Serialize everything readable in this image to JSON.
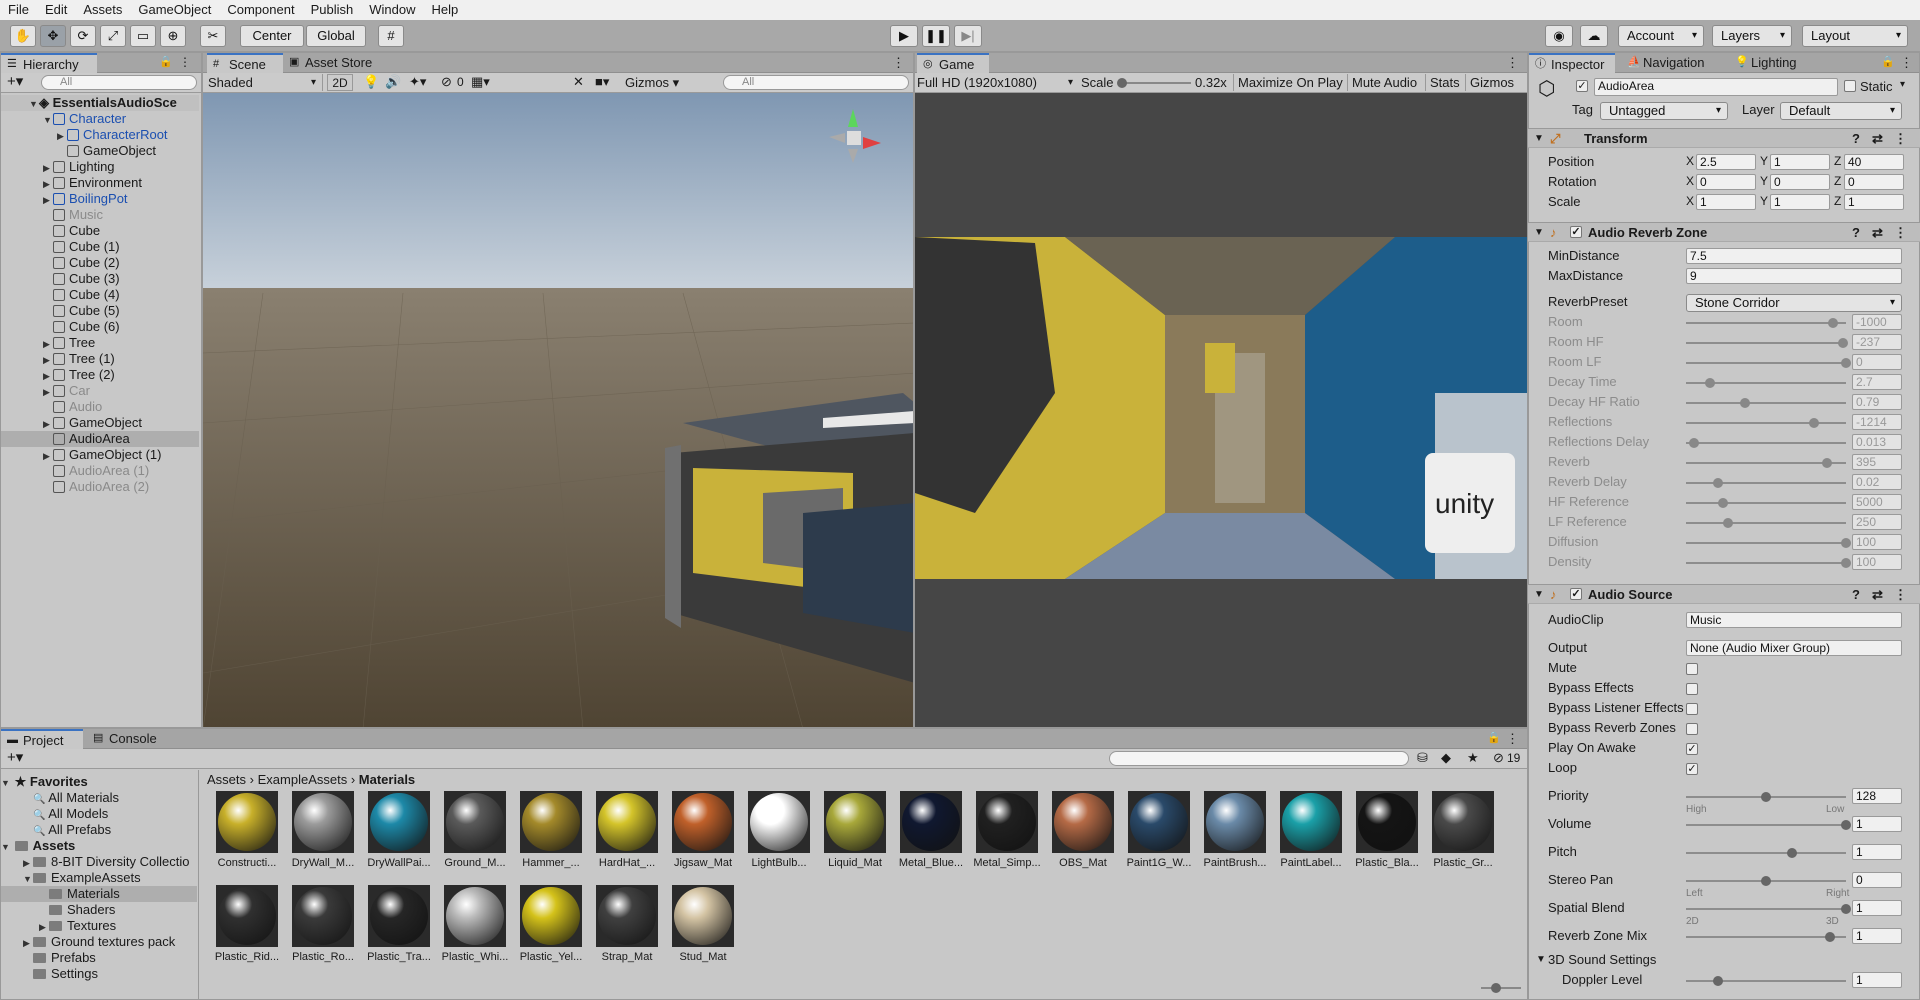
{
  "menu": [
    "File",
    "Edit",
    "Assets",
    "GameObject",
    "Component",
    "Publish",
    "Window",
    "Help"
  ],
  "toolbar": {
    "center": "Center",
    "global": "Global",
    "account": "Account",
    "layers": "Layers",
    "layout": "Layout"
  },
  "hierarchy": {
    "tab": "Hierarchy",
    "search_placeholder": "All",
    "scene": "EssentialsAudioSce",
    "items": [
      {
        "label": "Character",
        "indent": 1,
        "arrow": "▼",
        "style": "blue"
      },
      {
        "label": "CharacterRoot",
        "indent": 2,
        "arrow": "▶",
        "style": "blue"
      },
      {
        "label": "GameObject",
        "indent": 2,
        "arrow": "",
        "style": ""
      },
      {
        "label": "Lighting",
        "indent": 1,
        "arrow": "▶",
        "style": ""
      },
      {
        "label": "Environment",
        "indent": 1,
        "arrow": "▶",
        "style": ""
      },
      {
        "label": "BoilingPot",
        "indent": 1,
        "arrow": "▶",
        "style": "blue"
      },
      {
        "label": "Music",
        "indent": 1,
        "arrow": "",
        "style": "gray"
      },
      {
        "label": "Cube",
        "indent": 1,
        "arrow": "",
        "style": ""
      },
      {
        "label": "Cube (1)",
        "indent": 1,
        "arrow": "",
        "style": ""
      },
      {
        "label": "Cube (2)",
        "indent": 1,
        "arrow": "",
        "style": ""
      },
      {
        "label": "Cube (3)",
        "indent": 1,
        "arrow": "",
        "style": ""
      },
      {
        "label": "Cube (4)",
        "indent": 1,
        "arrow": "",
        "style": ""
      },
      {
        "label": "Cube (5)",
        "indent": 1,
        "arrow": "",
        "style": ""
      },
      {
        "label": "Cube (6)",
        "indent": 1,
        "arrow": "",
        "style": ""
      },
      {
        "label": "Tree",
        "indent": 1,
        "arrow": "▶",
        "style": ""
      },
      {
        "label": "Tree (1)",
        "indent": 1,
        "arrow": "▶",
        "style": ""
      },
      {
        "label": "Tree (2)",
        "indent": 1,
        "arrow": "▶",
        "style": ""
      },
      {
        "label": "Car",
        "indent": 1,
        "arrow": "▶",
        "style": "gray"
      },
      {
        "label": "Audio",
        "indent": 1,
        "arrow": "",
        "style": "gray"
      },
      {
        "label": "GameObject",
        "indent": 1,
        "arrow": "▶",
        "style": ""
      },
      {
        "label": "AudioArea",
        "indent": 1,
        "arrow": "",
        "style": "sel"
      },
      {
        "label": "GameObject (1)",
        "indent": 1,
        "arrow": "▶",
        "style": ""
      },
      {
        "label": "AudioArea (1)",
        "indent": 1,
        "arrow": "",
        "style": "gray"
      },
      {
        "label": "AudioArea (2)",
        "indent": 1,
        "arrow": "",
        "style": "gray"
      }
    ]
  },
  "scene": {
    "tab": "Scene",
    "tab2": "Asset Store",
    "shading": "Shaded",
    "mode2d": "2D",
    "hidden_count": "0",
    "gizmos": "Gizmos",
    "search_placeholder": "All"
  },
  "game": {
    "tab": "Game",
    "resolution": "Full HD (1920x1080)",
    "scale_label": "Scale",
    "scale_value": "0.32x",
    "maximize": "Maximize On Play",
    "mute": "Mute Audio",
    "stats": "Stats",
    "gizmos": "Gizmos"
  },
  "inspector": {
    "tabs": [
      "Inspector",
      "Navigation",
      "Lighting"
    ],
    "object_name": "AudioArea",
    "static": "Static",
    "tag_label": "Tag",
    "tag": "Untagged",
    "layer_label": "Layer",
    "layer": "Default",
    "transform": {
      "title": "Transform",
      "rows": [
        {
          "label": "Position",
          "x": "2.5",
          "y": "1",
          "z": "40"
        },
        {
          "label": "Rotation",
          "x": "0",
          "y": "0",
          "z": "0"
        },
        {
          "label": "Scale",
          "x": "1",
          "y": "1",
          "z": "1"
        }
      ]
    },
    "reverb": {
      "title": "Audio Reverb Zone",
      "min_label": "MinDistance",
      "min": "7.5",
      "max_label": "MaxDistance",
      "max": "9",
      "preset_label": "ReverbPreset",
      "preset": "Stone Corridor",
      "sliders": [
        {
          "label": "Room",
          "value": "-1000",
          "pos": 0.92
        },
        {
          "label": "Room HF",
          "value": "-237",
          "pos": 0.98
        },
        {
          "label": "Room LF",
          "value": "0",
          "pos": 1.0
        },
        {
          "label": "Decay Time",
          "value": "2.7",
          "pos": 0.15
        },
        {
          "label": "Decay HF Ratio",
          "value": "0.79",
          "pos": 0.37
        },
        {
          "label": "Reflections",
          "value": "-1214",
          "pos": 0.8
        },
        {
          "label": "Reflections Delay",
          "value": "0.013",
          "pos": 0.05
        },
        {
          "label": "Reverb",
          "value": "395",
          "pos": 0.88
        },
        {
          "label": "Reverb Delay",
          "value": "0.02",
          "pos": 0.2
        },
        {
          "label": "HF Reference",
          "value": "5000",
          "pos": 0.23
        },
        {
          "label": "LF Reference",
          "value": "250",
          "pos": 0.26
        },
        {
          "label": "Diffusion",
          "value": "100",
          "pos": 1.0
        },
        {
          "label": "Density",
          "value": "100",
          "pos": 1.0
        }
      ]
    },
    "source": {
      "title": "Audio Source",
      "clip_label": "AudioClip",
      "clip": "Music",
      "output_label": "Output",
      "output": "None (Audio Mixer Group)",
      "toggles": [
        {
          "label": "Mute",
          "checked": false
        },
        {
          "label": "Bypass Effects",
          "checked": false
        },
        {
          "label": "Bypass Listener Effects",
          "checked": false
        },
        {
          "label": "Bypass Reverb Zones",
          "checked": false
        },
        {
          "label": "Play On Awake",
          "checked": true
        },
        {
          "label": "Loop",
          "checked": true
        }
      ],
      "priority_label": "Priority",
      "priority": "128",
      "priority_pos": 0.5,
      "high": "High",
      "low": "Low",
      "volume_label": "Volume",
      "volume": "1",
      "volume_pos": 1.0,
      "pitch_label": "Pitch",
      "pitch": "1",
      "pitch_pos": 0.66,
      "pan_label": "Stereo Pan",
      "pan": "0",
      "pan_pos": 0.5,
      "left": "Left",
      "right": "Right",
      "blend_label": "Spatial Blend",
      "blend": "1",
      "blend_pos": 1.0,
      "two_d": "2D",
      "three_d": "3D",
      "mix_label": "Reverb Zone Mix",
      "mix": "1",
      "mix_pos": 0.9,
      "sound3d": "3D Sound Settings",
      "doppler_label": "Doppler Level",
      "doppler": "1",
      "doppler_pos": 0.2
    }
  },
  "project": {
    "tab": "Project",
    "tab2": "Console",
    "hidden_count": "19",
    "breadcrumb": [
      "Assets",
      "ExampleAssets",
      "Materials"
    ],
    "favorites_label": "Favorites",
    "favorites": [
      "All Materials",
      "All Models",
      "All Prefabs"
    ],
    "assets_label": "Assets",
    "folders": [
      {
        "label": "8-BIT Diversity Collectio",
        "indent": 1,
        "arrow": "▶"
      },
      {
        "label": "ExampleAssets",
        "indent": 1,
        "arrow": "▼"
      },
      {
        "label": "Materials",
        "indent": 2,
        "arrow": "",
        "sel": true
      },
      {
        "label": "Shaders",
        "indent": 2,
        "arrow": ""
      },
      {
        "label": "Textures",
        "indent": 2,
        "arrow": "▶"
      },
      {
        "label": "Ground textures pack",
        "indent": 1,
        "arrow": "▶"
      },
      {
        "label": "Prefabs",
        "indent": 1,
        "arrow": ""
      },
      {
        "label": "Settings",
        "indent": 1,
        "arrow": ""
      }
    ],
    "materials": [
      {
        "label": "Constructi...",
        "color": "#c8b02a"
      },
      {
        "label": "DryWall_M...",
        "color": "#9b9b9b"
      },
      {
        "label": "DryWallPai...",
        "color": "#1d89a8"
      },
      {
        "label": "Ground_M...",
        "color": "#5a5a5a"
      },
      {
        "label": "Hammer_...",
        "color": "#a48a2a"
      },
      {
        "label": "HardHat_...",
        "color": "#d4c42a"
      },
      {
        "label": "Jigsaw_Mat",
        "color": "#c0602a"
      },
      {
        "label": "LightBulb...",
        "color": "#ffffff"
      },
      {
        "label": "Liquid_Mat",
        "color": "#a8a83a"
      },
      {
        "label": "Metal_Blue...",
        "color": "#101830"
      },
      {
        "label": "Metal_Simp...",
        "color": "#202020"
      },
      {
        "label": "OBS_Mat",
        "color": "#b56a46"
      },
      {
        "label": "Paint1G_W...",
        "color": "#2a4a6a"
      },
      {
        "label": "PaintBrush...",
        "color": "#6a8aa8"
      },
      {
        "label": "PaintLabel...",
        "color": "#1aa0a8"
      },
      {
        "label": "Plastic_Bla...",
        "color": "#141414"
      },
      {
        "label": "Plastic_Gr...",
        "color": "#4a4a4a"
      },
      {
        "label": "Plastic_Rid...",
        "color": "#303030"
      },
      {
        "label": "Plastic_Ro...",
        "color": "#3a3a3a"
      },
      {
        "label": "Plastic_Tra...",
        "color": "#262626"
      },
      {
        "label": "Plastic_Whi...",
        "color": "#bbbbbb"
      },
      {
        "label": "Plastic_Yel...",
        "color": "#d4c21a"
      },
      {
        "label": "Strap_Mat",
        "color": "#404040"
      },
      {
        "label": "Stud_Mat",
        "color": "#d4c4a4"
      }
    ]
  }
}
